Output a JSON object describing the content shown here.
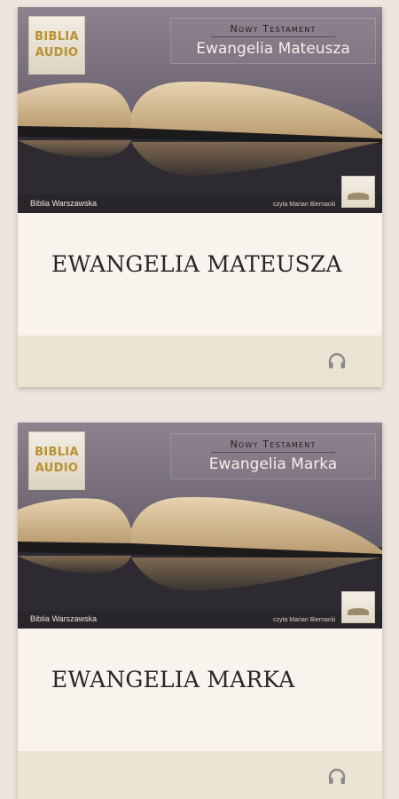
{
  "cards": [
    {
      "badge_line1": "BIBLIA",
      "badge_line2": "AUDIO",
      "testament": "Nowy Testament",
      "book_name": "Ewangelia Mateusza",
      "cover_left_caption": "Biblia Warszawska",
      "cover_right_caption": "czyta Marian Biernacki",
      "title": "EWANGELIA MATEUSZA",
      "action_icon": "headphones-icon"
    },
    {
      "badge_line1": "BIBLIA",
      "badge_line2": "AUDIO",
      "testament": "Nowy Testament",
      "book_name": "Ewangelia Marka",
      "cover_left_caption": "Biblia Warszawska",
      "cover_right_caption": "czyta Marian Biernacki",
      "title": "EWANGELIA MARKA",
      "action_icon": "headphones-icon"
    }
  ],
  "colors": {
    "page_background": "#ece6de",
    "card_background": "#f8f3ec",
    "card_footer": "#ebe4d2",
    "badge_text": "#b8922e",
    "title_text": "#2a2522",
    "icon": "#8a8a8a"
  }
}
